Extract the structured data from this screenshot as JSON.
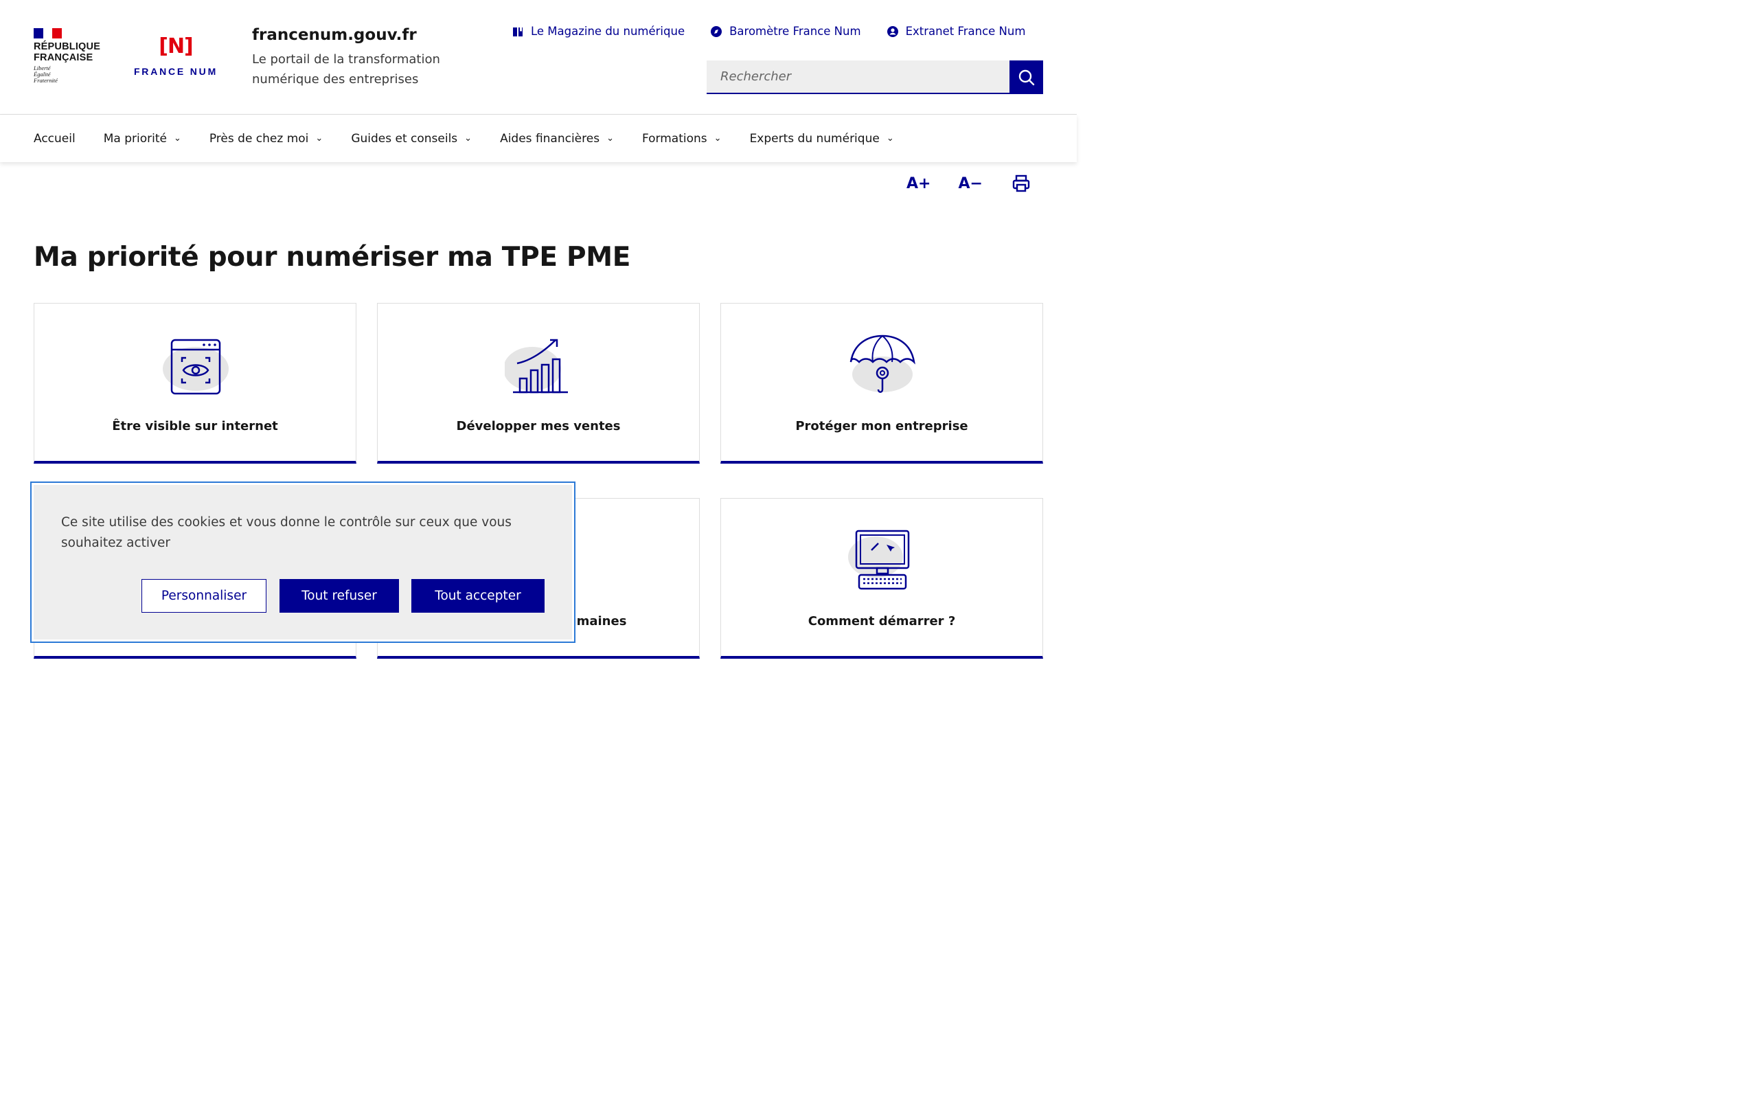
{
  "header": {
    "rf_logo": {
      "name_line1": "RÉPUBLIQUE",
      "name_line2": "FRANÇAISE",
      "motto1": "Liberté",
      "motto2": "Égalité",
      "motto3": "Fraternité"
    },
    "fn_logo": {
      "mark": "[N]",
      "text": "FRANCE NUM"
    },
    "site_title": "francenum.gouv.fr",
    "tagline": "Le portail de la transformation numérique des entreprises",
    "quick_links": [
      {
        "label": "Le Magazine du numérique",
        "icon": "book-icon"
      },
      {
        "label": "Baromètre France Num",
        "icon": "compass-icon"
      },
      {
        "label": "Extranet France Num",
        "icon": "user-circle-icon"
      }
    ],
    "search": {
      "placeholder": "Rechercher"
    }
  },
  "nav": {
    "items": [
      {
        "label": "Accueil",
        "has_dropdown": false
      },
      {
        "label": "Ma priorité",
        "has_dropdown": true
      },
      {
        "label": "Près de chez moi",
        "has_dropdown": true
      },
      {
        "label": "Guides et conseils",
        "has_dropdown": true
      },
      {
        "label": "Aides financières",
        "has_dropdown": true
      },
      {
        "label": "Formations",
        "has_dropdown": true
      },
      {
        "label": "Experts du numérique",
        "has_dropdown": true
      }
    ]
  },
  "tools": {
    "increase_text": "A+",
    "decrease_text": "A−"
  },
  "page_title": "Ma priorité pour numériser ma TPE PME",
  "cards": [
    {
      "label": "Être visible sur internet",
      "icon": "web-eye-icon"
    },
    {
      "label": "Développer mes ventes",
      "icon": "growth-chart-icon"
    },
    {
      "label": "Protéger mon entreprise",
      "icon": "umbrella-gear-icon"
    },
    {
      "label": "",
      "icon": ""
    },
    {
      "label": "s humaines",
      "icon": ""
    },
    {
      "label": "Comment démarrer ?",
      "icon": "computer-icon"
    }
  ],
  "cookie_banner": {
    "text": "Ce site utilise des cookies et vous donne le contrôle sur ceux que vous souhaitez activer",
    "personalize": "Personnaliser",
    "refuse_all": "Tout refuser",
    "accept_all": "Tout accepter"
  },
  "colors": {
    "primary": "#000091",
    "marianne_red": "#e1000f",
    "light_grey": "#eeeeee",
    "focus_blue": "#2b79d6"
  }
}
